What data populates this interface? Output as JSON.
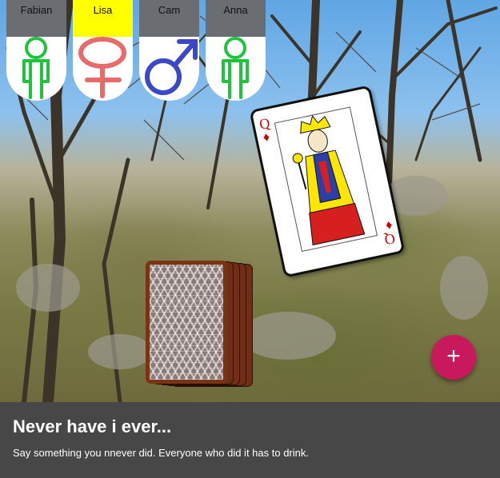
{
  "players": [
    {
      "name": "Fabian",
      "symbol": "neutral-figure-icon",
      "color": "#1fc43c",
      "active": false
    },
    {
      "name": "Lisa",
      "symbol": "female-symbol-icon",
      "color": "#e86a6a",
      "active": true
    },
    {
      "name": "Cam",
      "symbol": "male-symbol-icon",
      "color": "#3b49c8",
      "active": false
    },
    {
      "name": "Anna",
      "symbol": "neutral-figure-icon",
      "color": "#1fc43c",
      "active": false
    }
  ],
  "active_color": "#ffff00",
  "current_card": {
    "rank": "Q",
    "suit": "diamonds",
    "suit_glyph": "♦",
    "color": "#d40000"
  },
  "deck": {
    "back_color": "#7a3414"
  },
  "fab": {
    "label": "+",
    "color": "#c8195c"
  },
  "rule": {
    "title": "Never have i ever...",
    "description": "Say something you nnever did. Everyone who did it has to drink."
  }
}
